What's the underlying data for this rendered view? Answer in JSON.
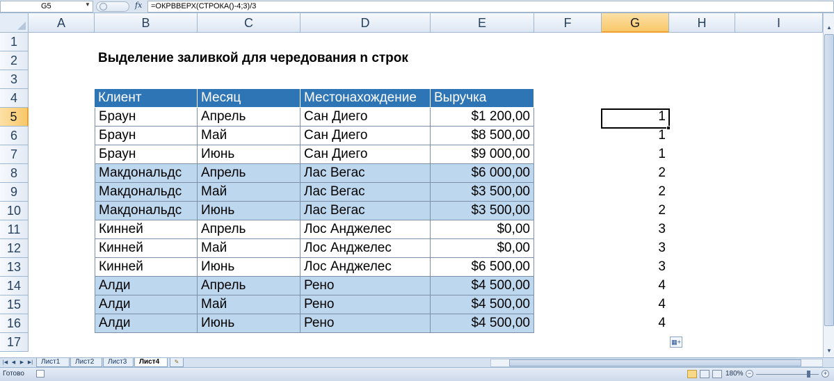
{
  "formula_bar": {
    "name_box": "G5",
    "fx_label": "fx",
    "formula": "=ОКРВВЕРХ(СТРОКА()-4;3)/3"
  },
  "columns": [
    "A",
    "B",
    "C",
    "D",
    "E",
    "F",
    "G",
    "H",
    "I"
  ],
  "active_column": "G",
  "rows": [
    "1",
    "2",
    "3",
    "4",
    "5",
    "6",
    "7",
    "8",
    "9",
    "10",
    "11",
    "12",
    "13",
    "14",
    "15",
    "16",
    "17"
  ],
  "active_row": "5",
  "title": "Выделение заливкой для чередования n строк",
  "table": {
    "headers": [
      "Клиент",
      "Месяц",
      "Местонахождение",
      "Выручка"
    ],
    "rows": [
      [
        "Браун",
        "Апрель",
        "Сан Диего",
        "$1 200,00"
      ],
      [
        "Браун",
        "Май",
        "Сан Диего",
        "$8 500,00"
      ],
      [
        "Браун",
        "Июнь",
        "Сан Диего",
        "$9 000,00"
      ],
      [
        "Макдональдс",
        "Апрель",
        "Лас Вегас",
        "$6 000,00"
      ],
      [
        "Макдональдс",
        "Май",
        "Лас Вегас",
        "$3 500,00"
      ],
      [
        "Макдональдс",
        "Июнь",
        "Лас Вегас",
        "$3 500,00"
      ],
      [
        "Кинней",
        "Апрель",
        "Лос Анджелес",
        "$0,00"
      ],
      [
        "Кинней",
        "Май",
        "Лос Анджелес",
        "$0,00"
      ],
      [
        "Кинней",
        "Июнь",
        "Лос Анджелес",
        "$6 500,00"
      ],
      [
        "Алди",
        "Апрель",
        "Рено",
        "$4 500,00"
      ],
      [
        "Алди",
        "Май",
        "Рено",
        "$4 500,00"
      ],
      [
        "Алди",
        "Июнь",
        "Рено",
        "$4 500,00"
      ]
    ],
    "shaded_rows": [
      3,
      4,
      5,
      9,
      10,
      11
    ]
  },
  "column_g_values": [
    "1",
    "1",
    "1",
    "2",
    "2",
    "2",
    "3",
    "3",
    "3",
    "4",
    "4",
    "4"
  ],
  "sheet_tabs": [
    "Лист1",
    "Лист2",
    "Лист3",
    "Лист4"
  ],
  "active_sheet": "Лист4",
  "status": {
    "ready": "Готово",
    "zoom": "180%"
  },
  "colors": {
    "header_fill": "#2e75b6",
    "band_fill": "#bdd7ee",
    "active_header": "#f8c86a"
  },
  "icons": {
    "name_box_dropdown": "chevron-down-icon",
    "paste_options": "paste-options-icon",
    "new_sheet": "insert-sheet-icon",
    "macro": "record-macro-icon"
  }
}
